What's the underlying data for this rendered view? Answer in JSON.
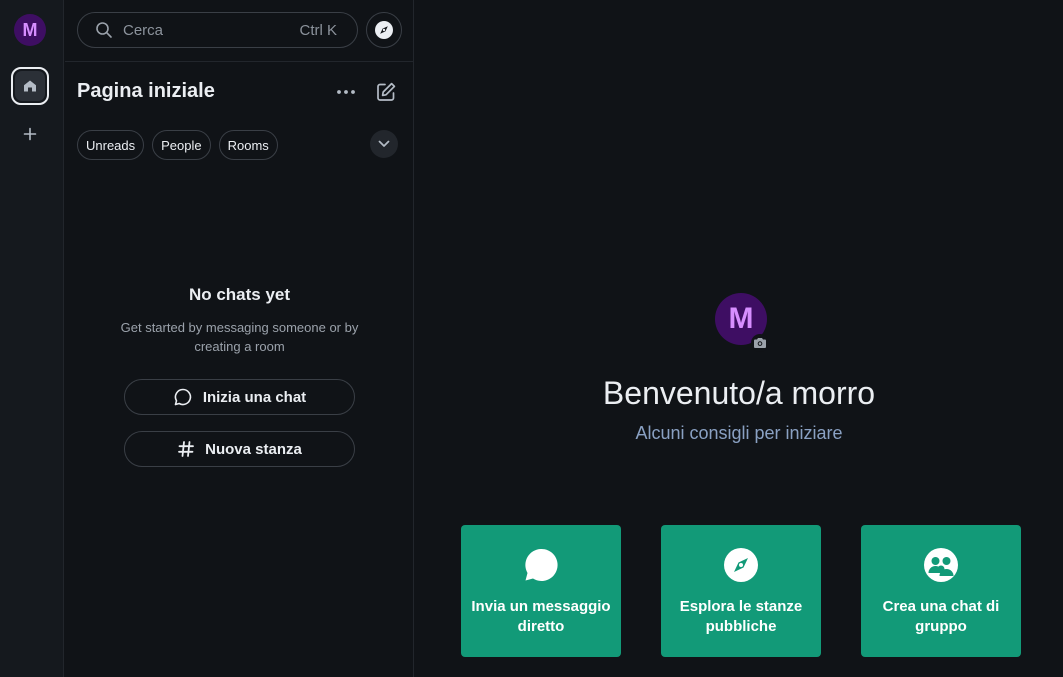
{
  "spacebar": {
    "user_initial": "M",
    "colors": {
      "avatar_bg": "#3e0e63",
      "avatar_fg": "#d78eff"
    }
  },
  "search": {
    "placeholder": "Cerca",
    "shortcut": "Ctrl K"
  },
  "room_list": {
    "title": "Pagina iniziale",
    "filters": [
      "Unreads",
      "People",
      "Rooms"
    ],
    "empty_title": "No chats yet",
    "empty_description": "Get started by messaging someone or by creating a room",
    "start_chat_label": "Inizia una chat",
    "new_room_label": "Nuova stanza"
  },
  "home": {
    "avatar_initial": "M",
    "title": "Benvenuto/a morro",
    "subtitle": "Alcuni consigli per iniziare",
    "cards": [
      {
        "label": "Invia un messaggio diretto",
        "icon": "chat-bubble-icon"
      },
      {
        "label": "Esplora le stanze pubbliche",
        "icon": "compass-icon"
      },
      {
        "label": "Crea una chat di gruppo",
        "icon": "group-icon"
      }
    ],
    "colors": {
      "card_bg": "#129a78",
      "subtitle": "#8aa1c3"
    }
  }
}
